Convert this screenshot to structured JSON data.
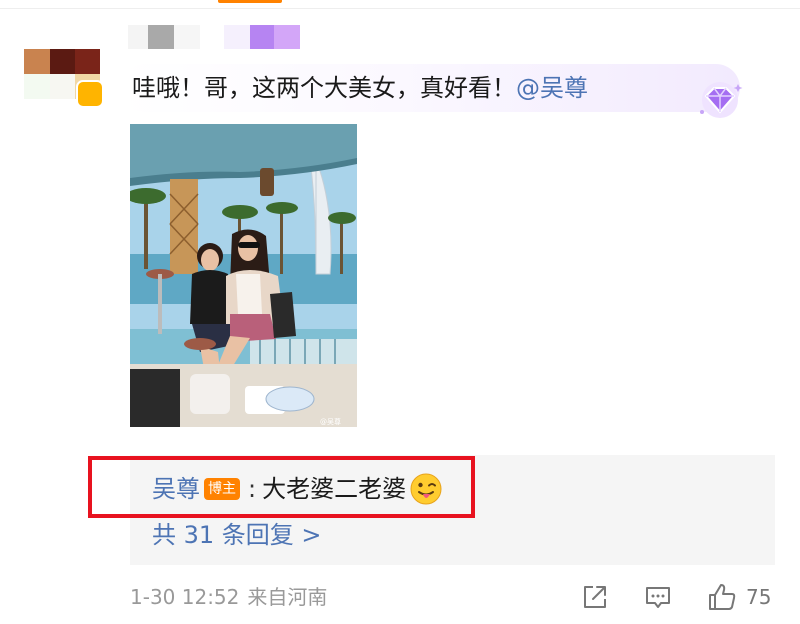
{
  "comment": {
    "text": "哇哦！哥，这两个大美女，真好看！",
    "mention": "@吴尊"
  },
  "reply": {
    "author": "吴尊",
    "badge": "博主",
    "colon": ":",
    "body": "大老婆二老婆",
    "emoji_icon": "tongue-wink-emoji-icon",
    "more_label": "共 31 条回复 >"
  },
  "meta": {
    "time": "1-30 12:52",
    "source": "来自河南",
    "like_count": "75"
  },
  "colors": {
    "accent": "#ff8200",
    "link": "#4d74b4",
    "highlight_border": "#e8121f",
    "meta_text": "#999999"
  },
  "icons": {
    "share": "share-icon",
    "comment": "comment-icon",
    "like": "thumbs-up-icon",
    "fan_badge": "purple-diamond-icon"
  }
}
